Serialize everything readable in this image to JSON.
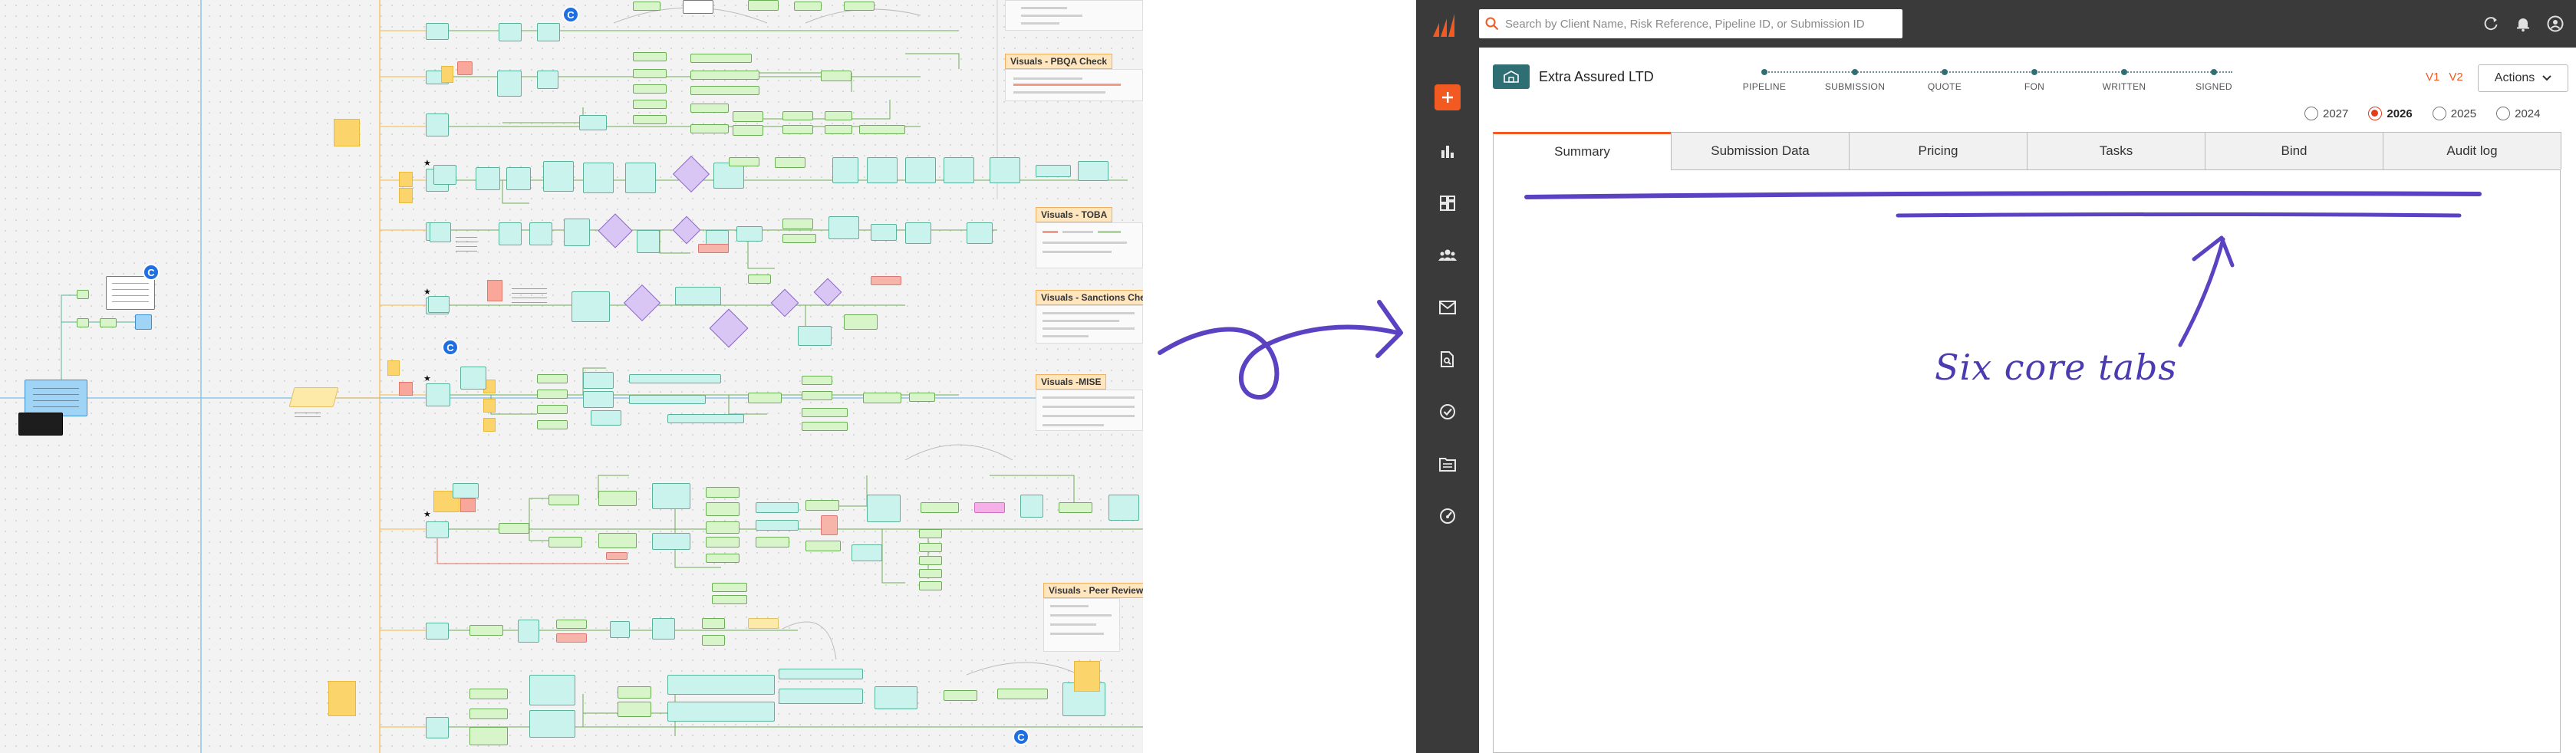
{
  "board": {
    "visual_titles": [
      "Visuals - PBQA Check",
      "Visuals - TOBA",
      "Visuals - Sanctions Checks",
      "Visuals -MISE",
      "Visuals - Peer Review"
    ],
    "collaborator_badge": "C"
  },
  "app": {
    "colors": {
      "accent": "#f25a22",
      "sidebar": "#3a3a3a",
      "brand_teal": "#2f6f73",
      "annotation": "#4b3bb0"
    },
    "search": {
      "placeholder": "Search by Client Name, Risk Reference, Pipeline ID, or Submission ID"
    },
    "top_icons": [
      "refresh-icon",
      "bell-icon",
      "user-icon"
    ],
    "nav": [
      "add-icon",
      "chart-icon",
      "dashboard-icon",
      "team-icon",
      "mail-icon",
      "document-search-icon",
      "check-circle-icon",
      "folder-icon",
      "gauge-icon"
    ],
    "company": {
      "name": "Extra Assured LTD"
    },
    "stages": [
      "PIPELINE",
      "SUBMISSION",
      "QUOTE",
      "FON",
      "WRITTEN",
      "SIGNED"
    ],
    "versions": [
      "V1",
      "V2"
    ],
    "actions_label": "Actions",
    "years": [
      {
        "label": "2027",
        "selected": false
      },
      {
        "label": "2026",
        "selected": true
      },
      {
        "label": "2025",
        "selected": false
      },
      {
        "label": "2024",
        "selected": false
      }
    ],
    "tabs": [
      "Summary",
      "Submission Data",
      "Pricing",
      "Tasks",
      "Bind",
      "Audit log"
    ],
    "active_tab": "Summary"
  },
  "annotation": {
    "text": "Six core tabs"
  }
}
